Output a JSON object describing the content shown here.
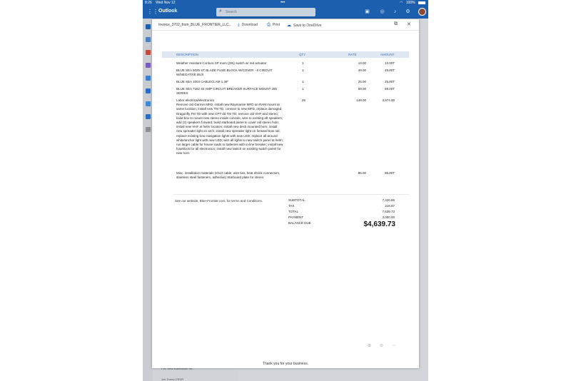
{
  "status_bar": {
    "time": "8:26",
    "date": "Wed Nov 12",
    "battery": "100%"
  },
  "app": {
    "title": "Outlook",
    "search_placeholder": "Search"
  },
  "viewer": {
    "file_name": "Invoice_3702_from_BLUE_FRONTIER_LLC...",
    "download_label": "Download",
    "print_label": "Print",
    "save_label": "Save to OneDrive"
  },
  "invoice": {
    "headers": {
      "description": "DESCRIPTION",
      "qty": "QTY",
      "rate": "RATE",
      "amount": "AMOUNT"
    },
    "rows": [
      {
        "description": "Weather resistant Contura SP mom (ON) switch w/ red actuator",
        "qty": "1",
        "rate": "13.00",
        "amount": "13.00T"
      },
      {
        "description": "BLUE SEA 5025 ST BLADE FUSE BLOCK W/COVER - 6 CIRCUIT W/NEGATIVE BUS",
        "qty": "1",
        "rate": "49.00",
        "amount": "49.00T"
      },
      {
        "description": "BLUE SEA 1003 CABLECLAM 1.39\"",
        "qty": "1",
        "rate": "25.00",
        "amount": "25.00T"
      },
      {
        "description": "BLUE SEA 7182 40 AMP CIRCUIT BREAKER SURFACE MOUNT 285 SERIES",
        "qty": "1",
        "rate": "59.00",
        "amount": "59.00T"
      },
      {
        "description": "Labor electrical/electronics\nRemove old Garmin MFD; install new Raymarine MFD on RAM mount at same location; install new TM TD, connect to new MFD, replace damaged Dragonfly TM TD with new CPT-dd TM TD; remove old VHF and stereo; build box to mount new stereo inside console, wire to existing aft speakers; add (2) speakers forward; build starboard panel to cover old stereo hole; install new VHF at helm location; install new deck mounted horn; install new spreader light on arch; install new spreader light on forward bow rail; replace existing bow navigation lights with new LED; replace all-around white/anchor light with new LED; wire all lights to new switch panel at helm; run larger cable for house loads to batteries with in-line breaker; install new fuseblock for all electronics; install new switch on existing switch panel for new horn",
        "qty": "26",
        "rate": "149.00",
        "amount": "3,874.00"
      },
      {
        "description": "Misc. installation materials (short cable, wire ties, heat shrink connectors, stainless steel fasteners, adhesive) Starboard plate for stereo",
        "qty": "",
        "rate": "95.00",
        "amount": "95.00T"
      }
    ],
    "footnote": "See our website, Blue-Frontier.com, for terms and Conditions.",
    "totals": [
      {
        "label": "SUBTOTAL",
        "value": "7,420.86"
      },
      {
        "label": "TAX",
        "value": "218.87"
      },
      {
        "label": "TOTAL",
        "value": "7,639.73"
      },
      {
        "label": "PAYMENT",
        "value": "3,000.00"
      }
    ],
    "balance_due_label": "BALANCE DUE",
    "balance_due_value": "$4,639.73",
    "thank_you": "Thank you for your business."
  },
  "background_list": {
    "row1": "FW: New submission fro...",
    "row2": "Jon Torres CRXR"
  },
  "colors": {
    "outlook_blue": "#1b5fae",
    "header_fill": "#dfe7f3",
    "header_text": "#3e70b4"
  }
}
